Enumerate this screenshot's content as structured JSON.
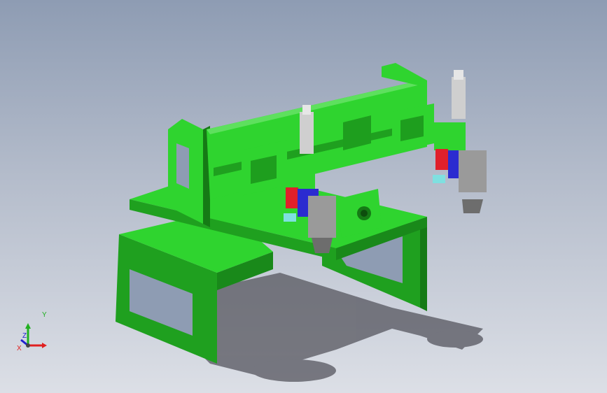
{
  "view": {
    "background_top": "#8e9cb3",
    "background_bottom": "#dcdfe6"
  },
  "model": {
    "description_icon": "cad-assembly-fixture",
    "colors": {
      "frame": "#2fd42f",
      "frame_dark": "#1e9e1e",
      "frame_shadow": "#157a15",
      "cylinder": "#c9c9c9",
      "gripper": "#9a9a9a",
      "red_part": "#e0202a",
      "blue_part": "#2b2bd0",
      "cyan_part": "#7fe0e0",
      "ground_shadow": "#4a4a52"
    }
  },
  "triad": {
    "x_label": "X",
    "y_label": "Y",
    "z_label": "Z",
    "x_color": "#e02020",
    "y_color": "#20b020",
    "z_color": "#2020d0"
  }
}
